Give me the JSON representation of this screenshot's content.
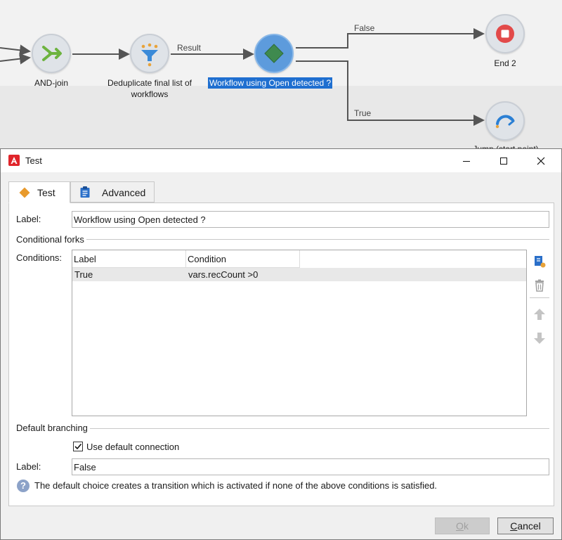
{
  "workflow": {
    "nodes": {
      "and_join": {
        "label": "AND-join"
      },
      "dedup": {
        "label_line1": "Deduplicate final list of",
        "label_line2": "workflows"
      },
      "test": {
        "label": "Workflow using Open detected ?"
      },
      "end": {
        "label": "End 2"
      },
      "jump": {
        "label": "Jump (start point)"
      }
    },
    "edges": {
      "result": "Result",
      "false": "False",
      "true": "True"
    }
  },
  "dialog": {
    "title": "Test",
    "tabs": [
      {
        "label": "Test"
      },
      {
        "label": "Advanced"
      }
    ],
    "label_field": {
      "label": "Label:",
      "value": "Workflow using Open detected ?"
    },
    "conditional_forks": {
      "title": "Conditional forks",
      "conditions_label": "Conditions:",
      "columns": [
        "Label",
        "Condition"
      ],
      "rows": [
        {
          "label": "True",
          "condition": "vars.recCount >0"
        }
      ]
    },
    "default_branching": {
      "title": "Default branching",
      "use_default_label": "Use default connection",
      "use_default_checked": true,
      "label_field": {
        "label": "Label:",
        "value": "False"
      },
      "help_text": "The default choice creates a transition which is activated if none of the above conditions is satisfied."
    },
    "buttons": {
      "ok_first": "O",
      "ok_rest": "k",
      "cancel_first": "C",
      "cancel_rest": "ancel"
    }
  },
  "colors": {
    "accent_selected": "#1f6fd0",
    "app_icon": "#e0252b",
    "tab_icon": "#e89a2c",
    "end_node": "#e24a4a",
    "jump_icon": "#2a7fd4"
  }
}
